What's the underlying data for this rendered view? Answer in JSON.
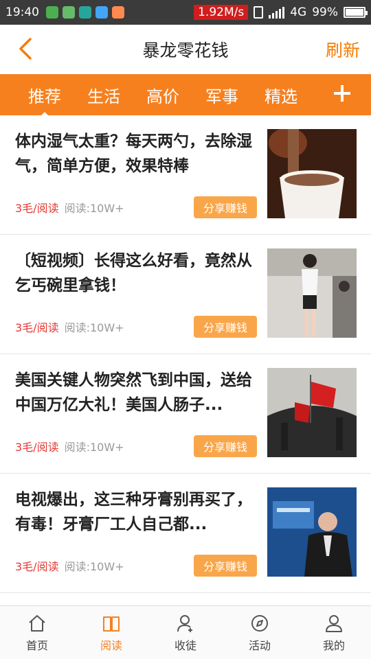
{
  "status_bar": {
    "time": "19:40",
    "speed": "1.92M/s",
    "network": "4G",
    "battery": "99%",
    "battery_level": 0.99
  },
  "header": {
    "title": "暴龙零花钱",
    "refresh_label": "刷新",
    "accent_color": "#f57c00"
  },
  "tabs": [
    {
      "label": "推荐",
      "active": true
    },
    {
      "label": "生活"
    },
    {
      "label": "高价"
    },
    {
      "label": "军事"
    },
    {
      "label": "精选"
    }
  ],
  "articles": [
    {
      "title": "体内湿气太重？每天两勺，去除湿气，简单方便，效果特棒",
      "price": "3毛/阅读",
      "reads": "阅读:10W+",
      "share_label": "分享赚钱",
      "image": "coffee-drink-image"
    },
    {
      "title": "〔短视频〕长得这么好看，竟然从乞丐碗里拿钱！",
      "price": "3毛/阅读",
      "reads": "阅读:10W+",
      "share_label": "分享赚钱",
      "image": "street-woman-image"
    },
    {
      "title": "美国关键人物突然飞到中国，送给中国万亿大礼！美国人肠子...",
      "price": "3毛/阅读",
      "reads": "阅读:10W+",
      "share_label": "分享赚钱",
      "image": "flag-ceremony-image"
    },
    {
      "title": "电视爆出，这三种牙膏别再买了，有毒！牙膏厂工人自己都...",
      "price": "3毛/阅读",
      "reads": "阅读:10W+",
      "share_label": "分享赚钱",
      "image": "news-anchor-image"
    }
  ],
  "bottom_nav": [
    {
      "label": "首页",
      "icon": "home-icon"
    },
    {
      "label": "阅读",
      "icon": "book-icon",
      "active": true
    },
    {
      "label": "收徒",
      "icon": "add-person-icon"
    },
    {
      "label": "活动",
      "icon": "compass-icon"
    },
    {
      "label": "我的",
      "icon": "user-icon"
    }
  ]
}
